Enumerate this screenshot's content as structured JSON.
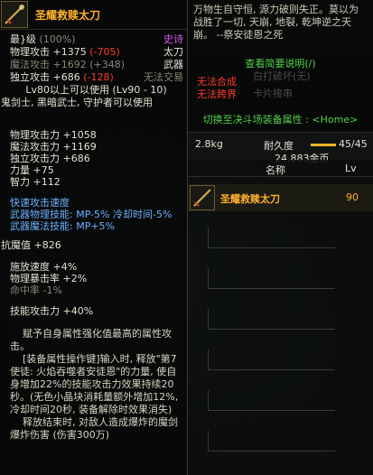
{
  "item": {
    "name": "圣耀救赎太刀",
    "min_level_label": "最}级",
    "min_level_pct": "(100%)",
    "rarity": "史诗",
    "phys_attack_label": "物理攻击",
    "phys_attack_value": "+1375",
    "phys_attack_diff": "(-705)",
    "weapon_type": "太刀",
    "mag_attack_label": "魔法攻击",
    "mag_attack_value": "+1692",
    "mag_attack_diff": "(+348)",
    "slot": "武器",
    "indep_attack_label": "独立攻击",
    "indep_attack_value": "+686",
    "indep_attack_diff": "(-128)",
    "trade": "无法交易",
    "level_req": "Lv80以上可以使用 (Lv90 - 10)",
    "classes": "鬼剑士, 黑暗武士, 守护者可以使用"
  },
  "stats": [
    "物理攻击力 +1058",
    "魔法攻击力 +1169",
    "独立攻击力 +686",
    "力量 +75",
    "智力 +112"
  ],
  "speed_stats": [
    "快速攻击速度",
    "武器物理技能: MP-5% 冷却时间-5%",
    "武器魔法技能: MP+5%"
  ],
  "resist": "抗魔值 +826",
  "bonus_stats": [
    "施放速度 +4%",
    "物理暴击率 +2%",
    "命中率 -1%"
  ],
  "skill_attack": "技能攻击力 +40%",
  "description": "    赋予自身属性强化值最高的属性攻击。\n    [装备属性操作键]输入时, 释放\"第7使徒: 火焰吞噬者安徒恩\"的力量, 使自身增加22%的技能攻击力效果持续20秒。(无色小晶块消耗量额外增加12%, 冷却时间20秒, 装备解除时效果消失)\n    释放结束时, 对敌人造成爆炸的魔剑爆炸伤害 (伤害300万)",
  "right_panel": {
    "motto": "万物生自守恒, 源力破则失正。莫以为战胜了一切, 天崩, 地裂, 乾坤逆之天崩。 --祭安徒恩之死",
    "view_intro": "查看简要说明(/)",
    "cannot_synth": "无法合成",
    "cannot_cross": "无法跨界",
    "ghost_1": "白打破坏(无)",
    "ghost_2": "卡片接串",
    "switch_label": "切换至决斗场装备属性 : <Home>",
    "weight": "2.8kg",
    "durability_label": "耐久度",
    "durability_value": "45/45",
    "durability_fraction": 1.0,
    "gold": "24,883金币",
    "list_name_header": "名称",
    "list_lv_header": "Lv",
    "list_item_name": "圣耀救赎太刀",
    "list_item_lv": "90"
  },
  "colors": {
    "epic": "#ffb12b",
    "red_warn": "#ff3b2a",
    "green_link": "#53d04a",
    "legendary_purple": "#d35af0"
  }
}
